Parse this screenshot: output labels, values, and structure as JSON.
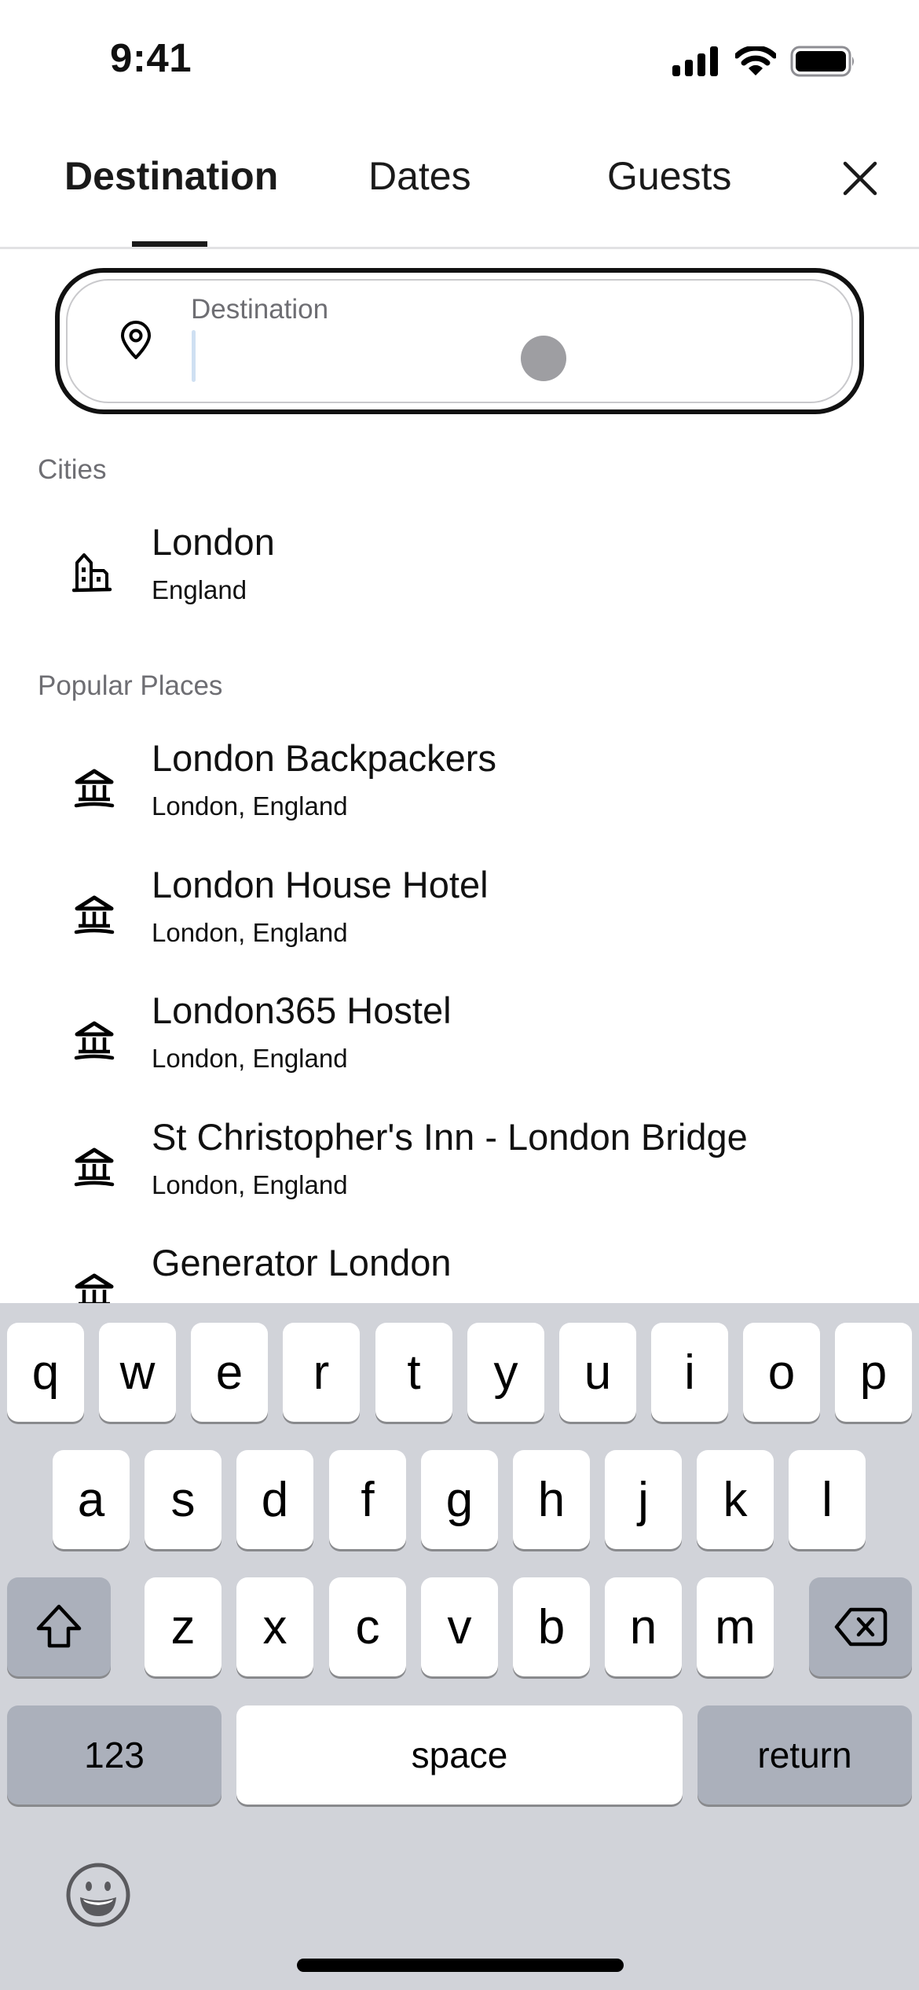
{
  "status_bar": {
    "time": "9:41",
    "icons": [
      "cellular-signal-icon",
      "wifi-icon",
      "battery-icon"
    ]
  },
  "tabs": [
    {
      "label": "Destination",
      "active": true
    },
    {
      "label": "Dates",
      "active": false
    },
    {
      "label": "Guests",
      "active": false
    }
  ],
  "close_icon": "close-icon",
  "search": {
    "icon": "map-pin-icon",
    "label": "Destination",
    "value": "",
    "placeholder": ""
  },
  "cities": {
    "header": "Cities",
    "items": [
      {
        "icon": "city-buildings-icon",
        "title": "London",
        "subtitle": "England"
      }
    ]
  },
  "popular_places": {
    "header": "Popular Places",
    "items": [
      {
        "icon": "landmark-icon",
        "title": "London Backpackers",
        "subtitle": "London, England"
      },
      {
        "icon": "landmark-icon",
        "title": "London House Hotel",
        "subtitle": "London, England"
      },
      {
        "icon": "landmark-icon",
        "title": "London365 Hostel",
        "subtitle": "London, England"
      },
      {
        "icon": "landmark-icon",
        "title": "St Christopher's Inn - London Bridge",
        "subtitle": "London, England"
      },
      {
        "icon": "landmark-icon",
        "title": "Generator London",
        "subtitle": ""
      }
    ]
  },
  "keyboard": {
    "row1": [
      "q",
      "w",
      "e",
      "r",
      "t",
      "y",
      "u",
      "i",
      "o",
      "p"
    ],
    "row2": [
      "a",
      "s",
      "d",
      "f",
      "g",
      "h",
      "j",
      "k",
      "l"
    ],
    "row3": [
      "z",
      "x",
      "c",
      "v",
      "b",
      "n",
      "m"
    ],
    "shift_icon": "shift-icon",
    "delete_icon": "backspace-icon",
    "numbers_label": "123",
    "space_label": "space",
    "return_label": "return",
    "emoji_icon": "emoji-icon"
  },
  "colors": {
    "text_primary": "#111111",
    "text_secondary": "#6e6e73",
    "keyboard_bg": "#d1d3d9",
    "key_fn_bg": "#abb0bb",
    "caret": "#cfe0f2"
  }
}
